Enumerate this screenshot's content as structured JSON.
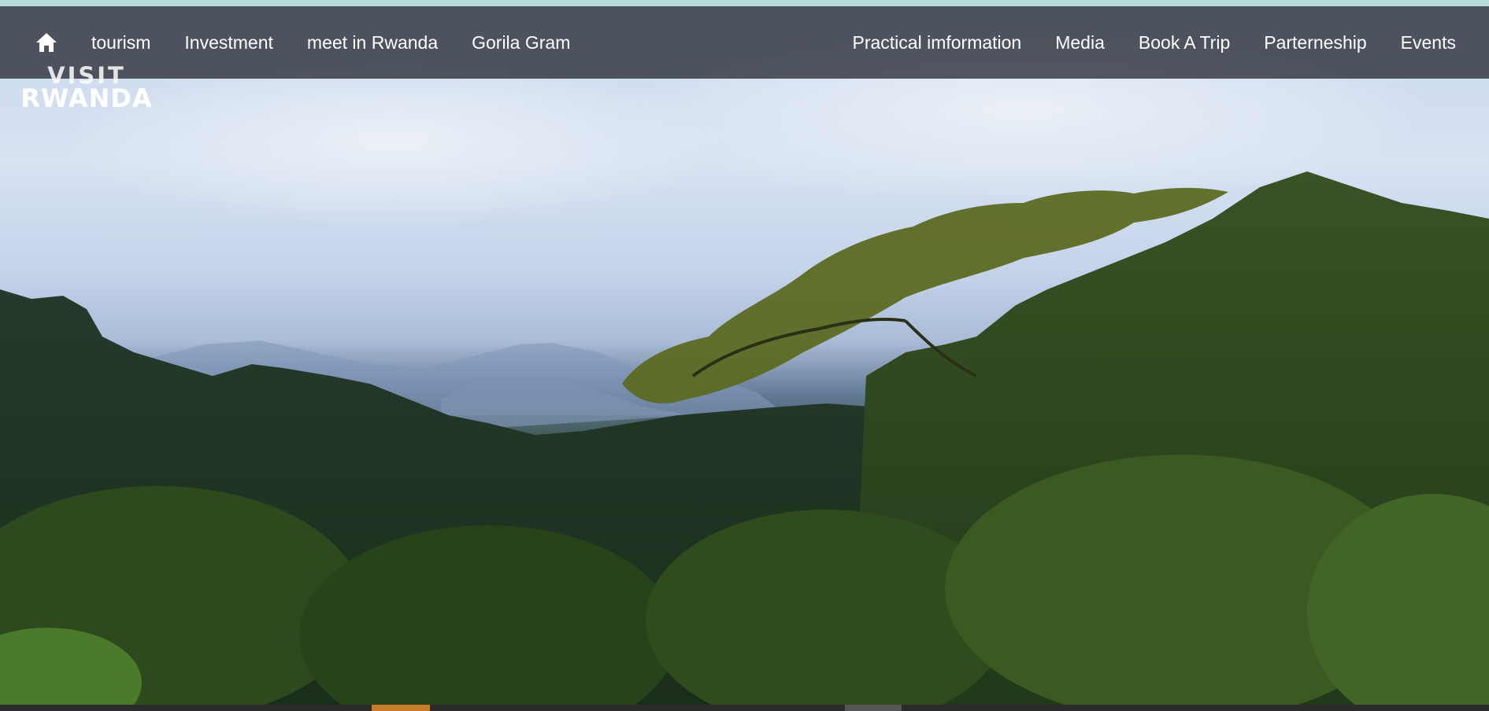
{
  "nav": {
    "home_icon": "home-icon",
    "left_links": [
      "tourism",
      "Investment",
      "meet in Rwanda",
      "Gorila Gram"
    ],
    "right_links": [
      "Practical imformation",
      "Media",
      "Book A Trip",
      "Parterneship",
      "Events"
    ]
  },
  "logo": {
    "line1": "VISIT",
    "line2": "RWANDA"
  },
  "colors": {
    "nav_background": "#282c34",
    "active_indicator": "#c97a2b",
    "top_strip": "#b9dcd9"
  }
}
